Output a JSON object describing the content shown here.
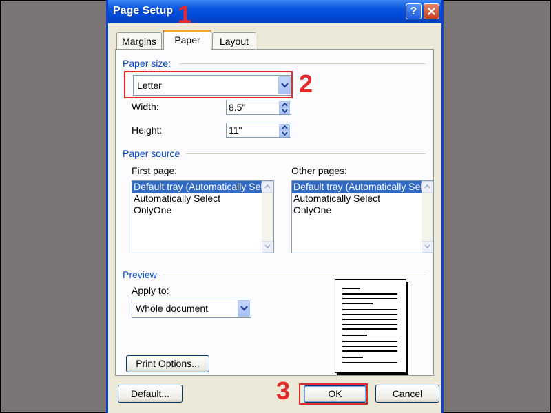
{
  "dialog": {
    "title": "Page Setup",
    "help_glyph": "?",
    "close_glyph": "✕"
  },
  "tabs": [
    {
      "label": "Margins"
    },
    {
      "label": "Paper",
      "active": true
    },
    {
      "label": "Layout"
    }
  ],
  "paper_size": {
    "group_label": "Paper size:",
    "selected": "Letter",
    "width_label": "Width:",
    "width_value": "8.5\"",
    "height_label": "Height:",
    "height_value": "11\""
  },
  "paper_source": {
    "group_label": "Paper source",
    "first_page_label": "First page:",
    "other_pages_label": "Other pages:",
    "options": [
      "Default tray (Automatically Select)",
      "Automatically Select",
      "OnlyOne"
    ],
    "first_page_selected_index": 0,
    "other_pages_selected_index": 0
  },
  "preview": {
    "group_label": "Preview",
    "apply_to_label": "Apply to:",
    "apply_to_value": "Whole document"
  },
  "buttons": {
    "print_options": "Print Options...",
    "default": "Default...",
    "ok": "OK",
    "cancel": "Cancel"
  },
  "annotations": {
    "marker_1": "1",
    "marker_2": "2",
    "marker_3": "3",
    "color": "#e42a2a"
  },
  "colors": {
    "titlebar": "#0a58e0",
    "dialog_bg": "#ece9d8",
    "group_label": "#0046d5",
    "selection": "#316ac5"
  }
}
